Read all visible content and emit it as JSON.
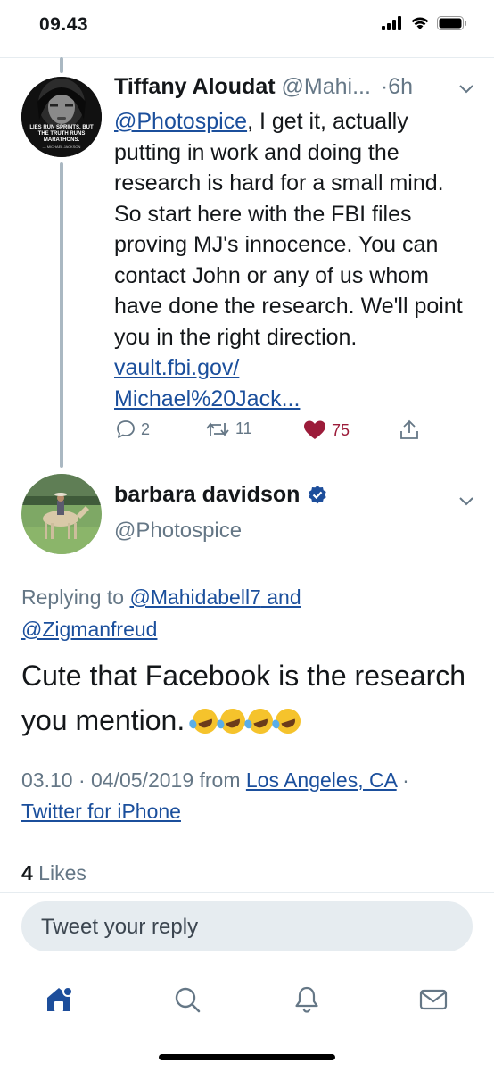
{
  "status_bar": {
    "time": "09.43"
  },
  "tweet_1": {
    "author_name": "Tiffany Aloudat",
    "author_handle": "@Mahi...",
    "time": "·6h",
    "mention": "@Photospice",
    "text": ", I get it, actually putting in work and doing the research is hard for a small mind. So start here with the FBI files proving MJ's innocence. You can contact John or any of us whom have done the research. We'll point you in the right direction. ",
    "link_line1": "vault.fbi.gov/",
    "link_line2": "Michael%20Jack...",
    "avatar_text": "LIES RUN SPRINTS, BUT THE TRUTH RUNS MARATHONS.",
    "avatar_credit": "— MICHAEL JACKSON",
    "replies": "2",
    "retweets": "11",
    "likes": "75"
  },
  "tweet_2": {
    "author_name": "barbara davidson",
    "author_handle": "@Photospice",
    "replying_prefix": "Replying to ",
    "replying_user1": "@Mahidabell7",
    "replying_and": " and",
    "replying_user2": "@Zigmanfreud",
    "text": "Cute that Facebook is the research you mention. ",
    "timestamp": "03.10 · 04/05/2019 from ",
    "location": "Los Angeles, CA",
    "separator": " · ",
    "source": "Twitter for iPhone",
    "likes_count": "4",
    "likes_label": " Likes"
  },
  "reply_box": {
    "placeholder": "Tweet your reply"
  },
  "colors": {
    "link": "#1b4f9c",
    "like": "#9c1c3a",
    "verified": "#1d4e9b",
    "secondary": "#657786"
  }
}
